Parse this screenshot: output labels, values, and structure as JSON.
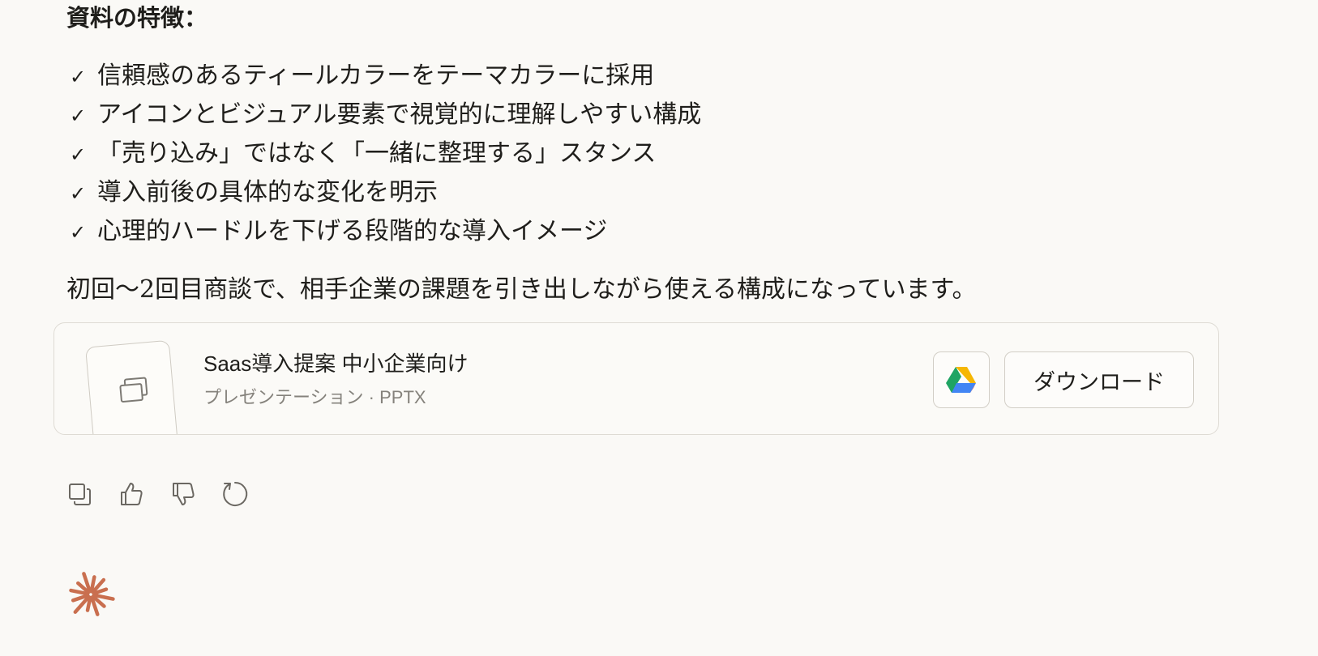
{
  "message": {
    "heading": "資料の特徴：",
    "check_mark": "✓",
    "features": [
      "信頼感のあるティールカラーをテーマカラーに採用",
      "アイコンとビジュアル要素で視覚的に理解しやすい構成",
      "「売り込み」ではなく「一緒に整理する」スタンス",
      "導入前後の具体的な変化を明示",
      "心理的ハードルを下げる段階的な導入イメージ"
    ],
    "summary": "初回〜2回目商談で、相手企業の課題を引き出しながら使える構成になっています。"
  },
  "file_card": {
    "name": "Saas導入提案 中小企業向け",
    "meta": "プレゼンテーション · PPTX",
    "drive_icon": "google-drive-icon",
    "download_label": "ダウンロード"
  },
  "actions": {
    "icons": [
      "copy-icon",
      "thumbs-up-icon",
      "thumbs-down-icon",
      "retry-icon"
    ]
  },
  "brand": {
    "spark_icon": "claude-spark-icon",
    "spark_color": "#c96f4f"
  }
}
